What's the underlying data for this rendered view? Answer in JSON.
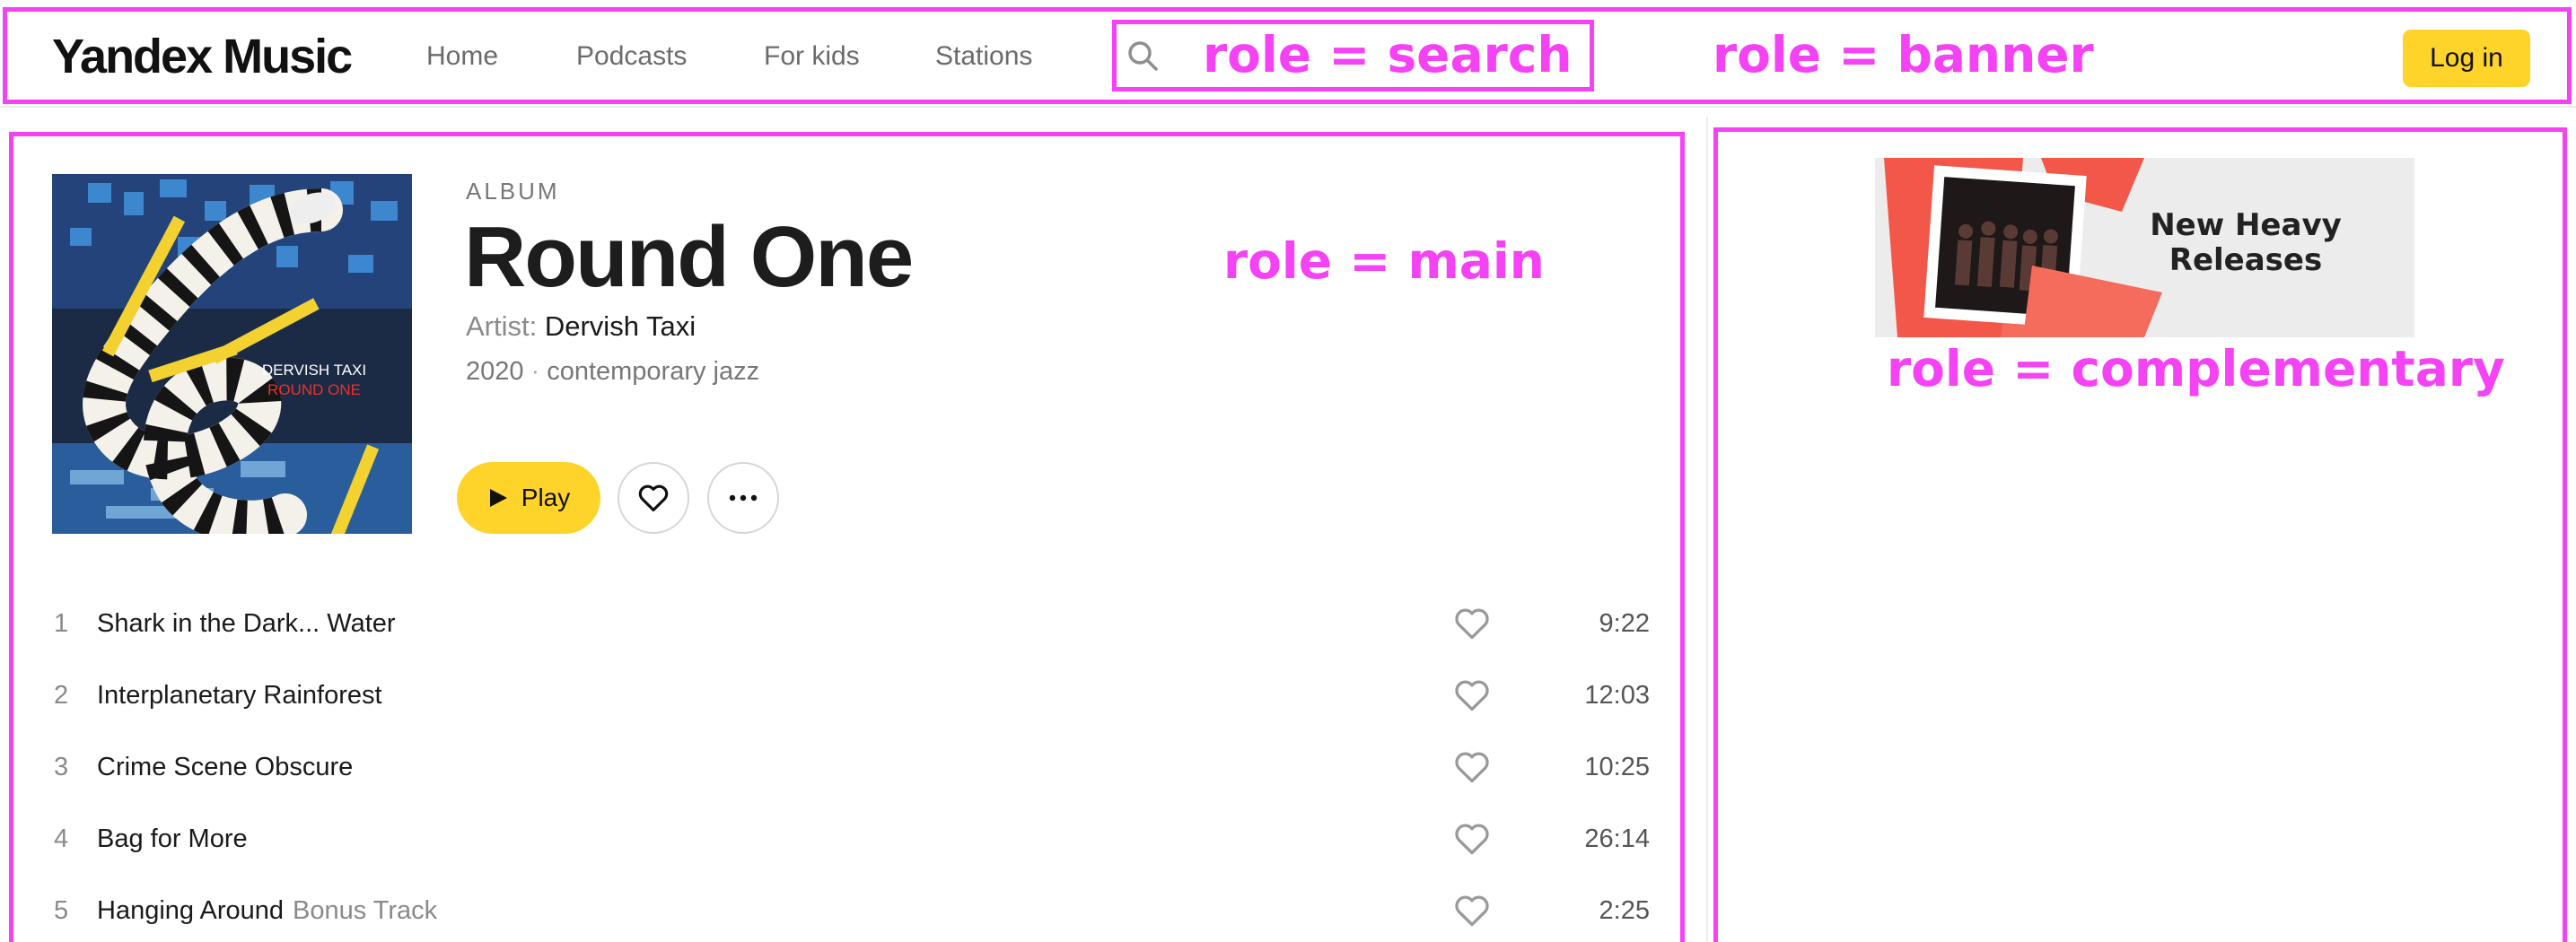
{
  "header": {
    "logo": "Yandex Music",
    "nav": [
      "Home",
      "Podcasts",
      "For kids",
      "Stations"
    ],
    "login_label": "Log in"
  },
  "album": {
    "type_label": "ALBUM",
    "title": "Round One",
    "artist_prefix": "Artist:",
    "artist": "Dervish Taxi",
    "year": "2020",
    "genre": "contemporary jazz",
    "cover_text_line1": "DERVISH TAXI",
    "cover_text_line2": "ROUND ONE",
    "cover_spine_text": "DERVISH TAXI"
  },
  "actions": {
    "play_label": "Play"
  },
  "tracks": [
    {
      "num": "1",
      "title": "Shark in the Dark... Water",
      "extra": "",
      "duration": "9:22"
    },
    {
      "num": "2",
      "title": "Interplanetary Rainforest",
      "extra": "",
      "duration": "12:03"
    },
    {
      "num": "3",
      "title": "Crime Scene Obscure",
      "extra": "",
      "duration": "10:25"
    },
    {
      "num": "4",
      "title": "Bag for More",
      "extra": "",
      "duration": "26:14"
    },
    {
      "num": "5",
      "title": "Hanging Around",
      "extra": "Bonus Track",
      "duration": "2:25"
    }
  ],
  "promo": {
    "title_line1": "New Heavy",
    "title_line2": "Releases"
  },
  "annotations": {
    "search": "role = search",
    "banner": "role = banner",
    "main": "role = main",
    "complementary": "role = complementary",
    "color": "#f542f5"
  },
  "colors": {
    "accent": "#fed42b",
    "promo_red": "#f2574a"
  }
}
